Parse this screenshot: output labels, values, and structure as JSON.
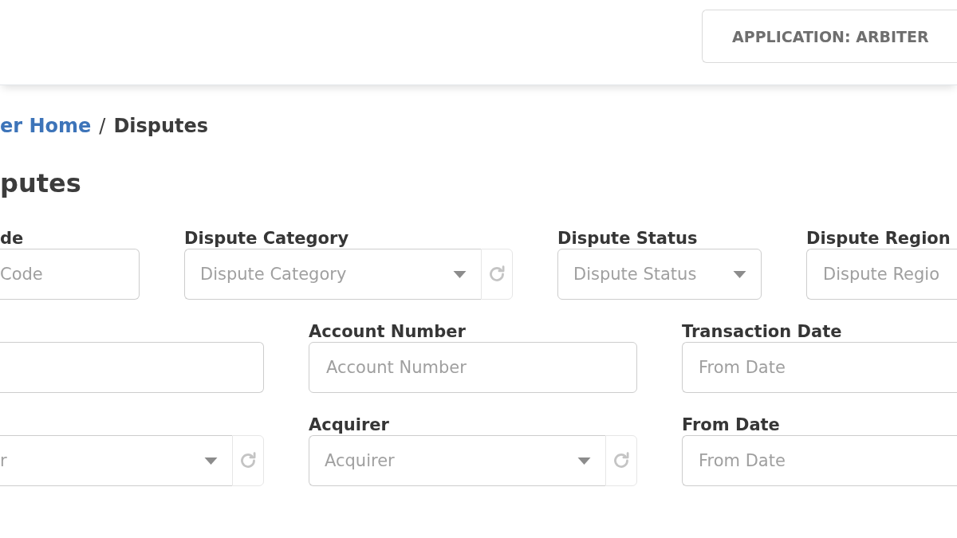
{
  "header": {
    "application_button": {
      "label": "APPLICATION: ARBITER"
    }
  },
  "breadcrumb": {
    "items": [
      {
        "label": "er Home",
        "kind": "link"
      },
      {
        "label": "Disputes",
        "kind": "current"
      }
    ],
    "separator": "/"
  },
  "page_title": "putes",
  "filter_rows": [
    {
      "fields": [
        {
          "kind": "input",
          "label": "de",
          "placeholder": "Code"
        },
        {
          "kind": "select",
          "label": "Dispute Category",
          "placeholder": "Dispute Category",
          "refresh": true
        },
        {
          "kind": "select",
          "label": "Dispute Status",
          "placeholder": "Dispute Status",
          "refresh": false
        },
        {
          "kind": "input",
          "label": "Dispute Region",
          "placeholder": "Dispute Regio"
        }
      ]
    },
    {
      "fields": [
        {
          "kind": "input"
        },
        {
          "kind": "input",
          "label": "Account Number",
          "placeholder": "Account Number"
        },
        {
          "kind": "input",
          "label": "Transaction Date",
          "placeholder": "From Date"
        }
      ]
    },
    {
      "fields": [
        {
          "kind": "select",
          "placeholder": "r",
          "refresh": true
        },
        {
          "kind": "select",
          "label": "Acquirer",
          "placeholder": "Acquirer",
          "refresh": true
        },
        {
          "kind": "input",
          "label": "From Date",
          "placeholder": "From Date"
        }
      ]
    }
  ]
}
